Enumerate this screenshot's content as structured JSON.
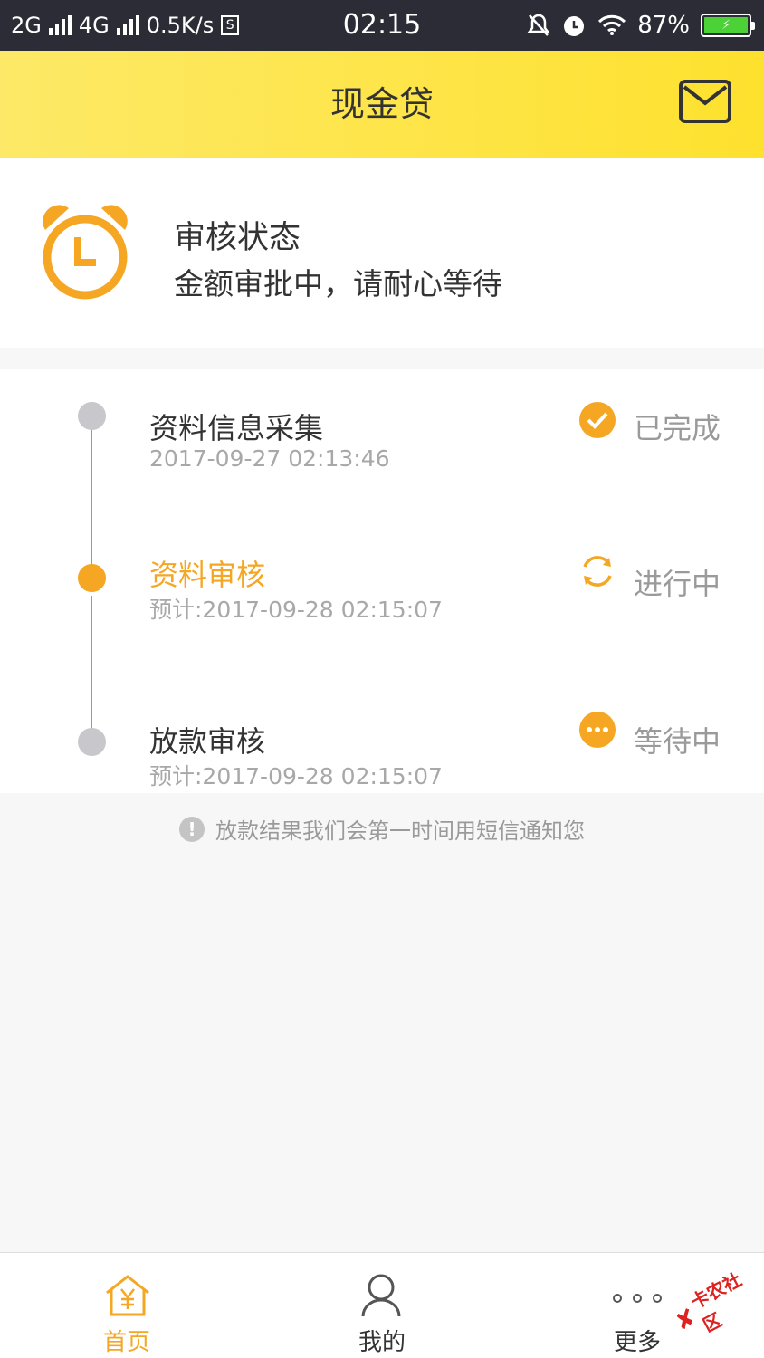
{
  "statusbar": {
    "net1": "2G",
    "net2": "4G",
    "speed": "0.5K/s",
    "time": "02:15",
    "battery": "87%"
  },
  "header": {
    "title": "现金贷",
    "mail_icon": "mail-icon"
  },
  "review": {
    "title": "审核状态",
    "desc": "金额审批中，请耐心等待",
    "icon": "alarm-clock-icon"
  },
  "steps": [
    {
      "name": "资料信息采集",
      "time": "2017-09-27 02:13:46",
      "state": "已完成",
      "icon": "check-circle-icon"
    },
    {
      "name": "资料审核",
      "time": "预计:2017-09-28 02:15:07",
      "state": "进行中",
      "icon": "refresh-icon"
    },
    {
      "name": "放款审核",
      "time": "预计:2017-09-28 02:15:07",
      "state": "等待中",
      "icon": "more-circle-icon"
    }
  ],
  "notice": "放款结果我们会第一时间用短信通知您",
  "tabs": [
    {
      "label": "首页",
      "icon": "home-yuan-icon",
      "active": true
    },
    {
      "label": "我的",
      "icon": "user-icon",
      "active": false
    },
    {
      "label": "更多",
      "icon": "more-dots-icon",
      "active": false
    }
  ],
  "watermark": "卡农社区",
  "colors": {
    "accent": "#f5a623",
    "header_yellow": "#fee12e",
    "done_gray": "#c8c8cc"
  }
}
